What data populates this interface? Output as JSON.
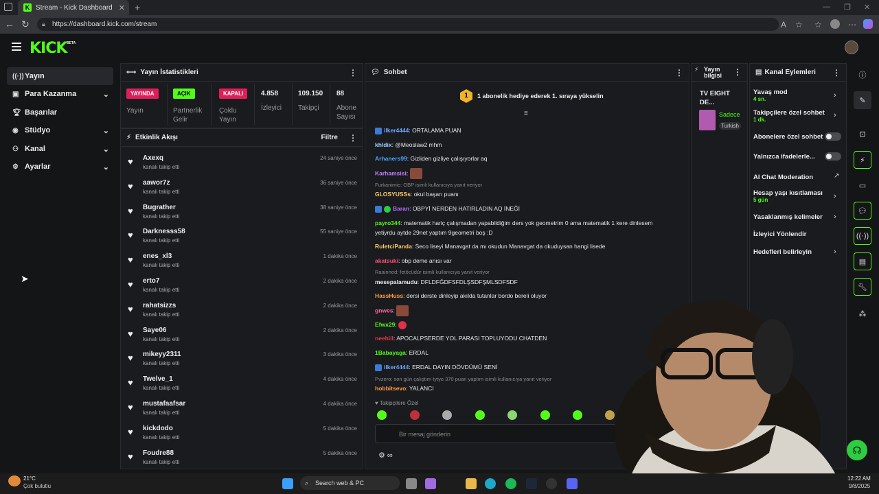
{
  "browser": {
    "tab_title": "Stream - Kick Dashboard",
    "url": "https://dashboard.kick.com/stream"
  },
  "brand": {
    "logo": "KICK",
    "beta": "BETA",
    "accent": "#53fc18"
  },
  "sidebar": {
    "items": [
      {
        "label": "Yayın",
        "icon": "broadcast-icon"
      },
      {
        "label": "Para Kazanma",
        "icon": "wallet-icon"
      },
      {
        "label": "Başarılar",
        "icon": "trophy-icon"
      },
      {
        "label": "Stüdyo",
        "icon": "studio-icon"
      },
      {
        "label": "Kanal",
        "icon": "channel-icon"
      },
      {
        "label": "Ayarlar",
        "icon": "gear-icon"
      }
    ]
  },
  "stats": {
    "title": "Yayın İstatistikleri",
    "live_badge": "YAYINDA",
    "live_label": "Yayın",
    "partner_badge": "AÇIK",
    "partner_label": "Partnerlik Gelir",
    "multi_badge": "KAPALI",
    "multi_label": "Çoklu Yayın",
    "viewers": "4.858",
    "viewers_label": "İzleyici",
    "followers": "109.150",
    "followers_label": "Takipçi",
    "subs": "88",
    "subs_label": "Abone Sayısı"
  },
  "activity": {
    "title": "Etkinlik Akışı",
    "filter": "Filtre",
    "items": [
      {
        "name": "Axexq",
        "sub": "kanalı takip etti",
        "time": "24 saniye önce"
      },
      {
        "name": "aawor7z",
        "sub": "kanalı takip etti",
        "time": "36 saniye önce"
      },
      {
        "name": "Bugrather",
        "sub": "kanalı takip etti",
        "time": "38 saniye önce"
      },
      {
        "name": "Darknesss58",
        "sub": "kanalı takip etti",
        "time": "55 saniye önce"
      },
      {
        "name": "enes_xl3",
        "sub": "kanalı takip etti",
        "time": "1 dakika önce"
      },
      {
        "name": "erto7",
        "sub": "kanalı takip etti",
        "time": "2 dakika önce"
      },
      {
        "name": "rahatsizzs",
        "sub": "kanalı takip etti",
        "time": "2 dakika önce"
      },
      {
        "name": "Saye06",
        "sub": "kanalı takip etti",
        "time": "2 dakika önce"
      },
      {
        "name": "mikeyy2311",
        "sub": "kanalı takip etti",
        "time": "3 dakika önce"
      },
      {
        "name": "Twelve_1",
        "sub": "kanalı takip etti",
        "time": "4 dakika önce"
      },
      {
        "name": "mustafaafsar",
        "sub": "kanalı takip etti",
        "time": "4 dakika önce"
      },
      {
        "name": "kickdodo",
        "sub": "kanalı takip etti",
        "time": "5 dakika önce"
      },
      {
        "name": "Foudre88",
        "sub": "kanalı takip etti",
        "time": "5 dakika önce"
      }
    ]
  },
  "chat": {
    "title": "Sohbet",
    "gift_num": "1",
    "gift_text": "1 abonelik hediye ederek 1. sıraya yükselin",
    "lines": [
      {
        "user": "ilker4444",
        "color": "#6fa8ff",
        "text": ": ORTALAMA PUAN"
      },
      {
        "user": "khldix",
        "color": "#9ad0ff",
        "text": ": @Meoslaw2 mhm"
      },
      {
        "user": "Arhaners99",
        "color": "#4aa3ff",
        "text": ": Gizliden gizliye çalışıyorlar aq"
      },
      {
        "user": "Karhamsisi",
        "color": "#c77dff",
        "text": ":"
      },
      {
        "user": "GLOSYUSSs",
        "color": "#ffd166",
        "text": ": okul başarı puanı"
      },
      {
        "user": "Baran",
        "color": "#b36bff",
        "text": ": OBPYİ NERDEN HATIRLADIN AQ İNEĞİ"
      },
      {
        "user": "payro344",
        "color": "#53fc18",
        "text": ": matematik hariç çalışmadan yapabildiğim ders yok geometrim 0 ama matematik 1 kere dinlesem yetiyrdu aytde 29net yaptım 9geometri boş :D"
      },
      {
        "user": "RuletciPanda",
        "color": "#ffcc66",
        "text": ": Seco liseyi Manavgat da mı okudun Manavgat da okuduysan hangi lisede"
      },
      {
        "user": "akatsuki",
        "color": "#ff4d6d",
        "text": ": obp deme anısı var"
      },
      {
        "user": "mesepalamudu",
        "color": "#eeeeee",
        "text": ": DFLDFĞDFSFDLŞSDFŞMLSDFSDF"
      },
      {
        "user": "HassHuss",
        "color": "#ff9f43",
        "text": ": dersi derste dinleyip akılda tutanlar bordo bereli oluyor"
      },
      {
        "user": "gnwes",
        "color": "#ff6b9a",
        "text": ":"
      },
      {
        "user": "Efwx29",
        "color": "#53fc18",
        "text": ":"
      },
      {
        "user": "neehiil",
        "color": "#e03a4e",
        "text": ": APOCALPSERDE YOL PARASI TOPLUYODU CHATDEN"
      },
      {
        "user": "1Babayaga",
        "color": "#53fc18",
        "text": ": ERDAL"
      },
      {
        "user": "ilker4444",
        "color": "#6fa8ff",
        "text": ": ERDAL DAYIN DÖVDÜMÜ SENİ"
      },
      {
        "user": "hobbitsevo",
        "color": "#ff9f43",
        "text": ": YALANCI"
      }
    ],
    "reply1": "Furkanimio: OBP isimli kullanıcıya yanıt veriyor",
    "reply2": "Raainned: fetöcüdür isimli kullanıcıya yanıt veriyor",
    "reply3": "Pvzero: son gün çalıştım tytye 370 puan yaptım isimli kullanıcıya yanıt veriyor",
    "followers_only": "Takipçilere Özel",
    "placeholder": "Bir mesaj gönderin"
  },
  "stream_info": {
    "title": "Yayın bilgisi",
    "stream_title": "TV EIGHT DE...",
    "tag1": "Sadece",
    "tag2": "Turkish"
  },
  "channel": {
    "title": "Kanal Eylemleri",
    "items": [
      {
        "label": "Yavaş mod",
        "sub": "4 sn."
      },
      {
        "label": "Takipçilere özel sohbet",
        "sub": "1 dk."
      },
      {
        "label": "Abonelere özel sohbet",
        "sub": ""
      },
      {
        "label": "Yalnızca ifadelerle...",
        "sub": ""
      },
      {
        "label": "AI Chat Moderation",
        "sub": ""
      },
      {
        "label": "Hesap yaşı kısıtlaması",
        "sub": "5 gün"
      },
      {
        "label": "Yasaklanmış kelimeler",
        "sub": ""
      },
      {
        "label": "İzleyici Yönlendir",
        "sub": ""
      },
      {
        "label": "Hedefleri belirleyin",
        "sub": ""
      }
    ]
  },
  "taskbar": {
    "temp": "21°C",
    "weather": "Çok bulutlu",
    "search": "Search web & PC",
    "time": "12:22 AM",
    "date": "9/8/2025"
  }
}
